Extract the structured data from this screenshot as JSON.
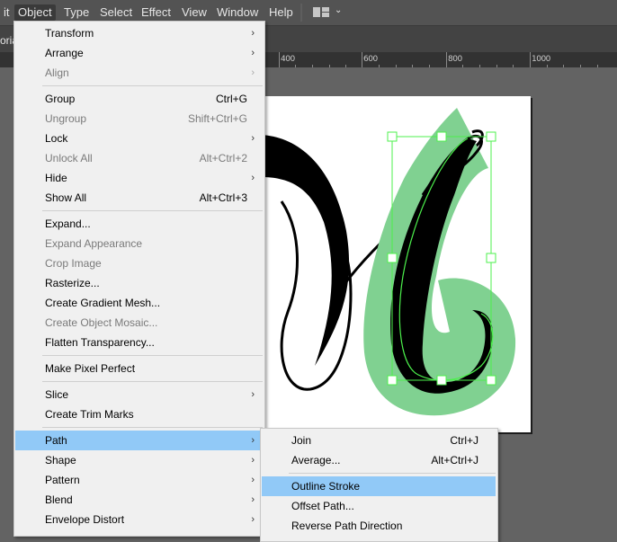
{
  "menubar": {
    "items": [
      {
        "label": "it"
      },
      {
        "label": "Object",
        "active": true
      },
      {
        "label": "Type"
      },
      {
        "label": "Select"
      },
      {
        "label": "Effect"
      },
      {
        "label": "View"
      },
      {
        "label": "Window"
      },
      {
        "label": "Help"
      }
    ],
    "workspace_icon": "workspace-layout-icon",
    "workspace_chevron": "⌄"
  },
  "document_tab": {
    "partial_label": "oria"
  },
  "ruler": {
    "labels": [
      "400",
      "600",
      "800",
      "1000"
    ]
  },
  "object_menu": {
    "items": [
      {
        "label": "Transform",
        "submenu": true
      },
      {
        "label": "Arrange",
        "submenu": true
      },
      {
        "label": "Align",
        "submenu": true,
        "disabled": true
      },
      {
        "label": "Group",
        "shortcut": "Ctrl+G"
      },
      {
        "label": "Ungroup",
        "shortcut": "Shift+Ctrl+G",
        "disabled": true
      },
      {
        "label": "Lock",
        "submenu": true
      },
      {
        "label": "Unlock All",
        "shortcut": "Alt+Ctrl+2",
        "disabled": true
      },
      {
        "label": "Hide",
        "submenu": true
      },
      {
        "label": "Show All",
        "shortcut": "Alt+Ctrl+3"
      },
      {
        "label": "Expand..."
      },
      {
        "label": "Expand Appearance",
        "disabled": true
      },
      {
        "label": "Crop Image",
        "disabled": true
      },
      {
        "label": "Rasterize..."
      },
      {
        "label": "Create Gradient Mesh..."
      },
      {
        "label": "Create Object Mosaic...",
        "disabled": true
      },
      {
        "label": "Flatten Transparency..."
      },
      {
        "label": "Make Pixel Perfect"
      },
      {
        "label": "Slice",
        "submenu": true
      },
      {
        "label": "Create Trim Marks"
      },
      {
        "label": "Path",
        "submenu": true,
        "highlighted": true
      },
      {
        "label": "Shape",
        "submenu": true
      },
      {
        "label": "Pattern",
        "submenu": true
      },
      {
        "label": "Blend",
        "submenu": true
      },
      {
        "label": "Envelope Distort",
        "submenu": true
      }
    ],
    "submenu_arrow": "›"
  },
  "path_submenu": {
    "items": [
      {
        "label": "Join",
        "shortcut": "Ctrl+J"
      },
      {
        "label": "Average...",
        "shortcut": "Alt+Ctrl+J"
      },
      {
        "label": "Outline Stroke",
        "highlighted": true
      },
      {
        "label": "Offset Path..."
      },
      {
        "label": "Reverse Path Direction"
      }
    ]
  },
  "colors": {
    "menubar_bg": "#535353",
    "menu_bg": "#f0f0f0",
    "highlight": "#91c9f7",
    "disabled_text": "#7a7a7a",
    "stroke_green": "#80d191",
    "selection_green": "#4cf04c",
    "canvas_bg": "#636363"
  }
}
